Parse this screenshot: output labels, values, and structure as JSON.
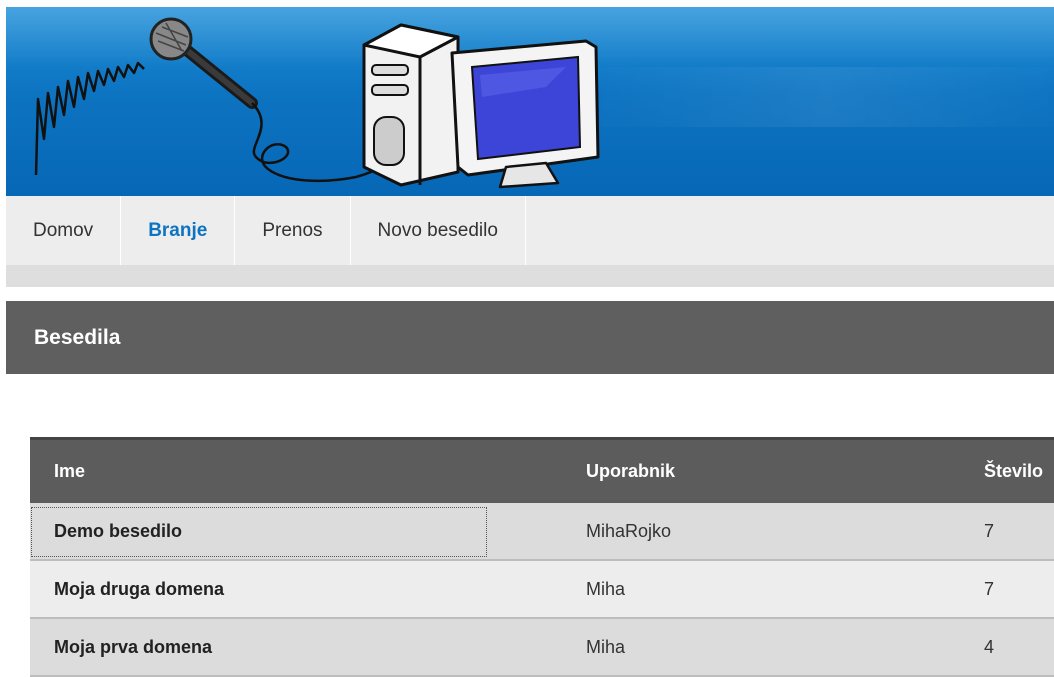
{
  "header": {
    "logo_icons": [
      "microphone-icon",
      "computer-icon"
    ]
  },
  "nav": {
    "items": [
      {
        "label": "Domov",
        "active": false
      },
      {
        "label": "Branje",
        "active": true
      },
      {
        "label": "Prenos",
        "active": false
      },
      {
        "label": "Novo besedilo",
        "active": false
      }
    ]
  },
  "section": {
    "title": "Besedila"
  },
  "table": {
    "columns": [
      "Ime",
      "Uporabnik",
      "Število"
    ],
    "rows": [
      {
        "name": "Demo besedilo",
        "user": "MihaRojko",
        "count": "7"
      },
      {
        "name": "Moja druga domena",
        "user": "Miha",
        "count": "7"
      },
      {
        "name": "Moja prva domena",
        "user": "Miha",
        "count": "4"
      }
    ]
  },
  "colors": {
    "header_blue": "#0d74c2",
    "nav_active": "#0d74c2",
    "dark_bar": "#5f5f5f"
  }
}
